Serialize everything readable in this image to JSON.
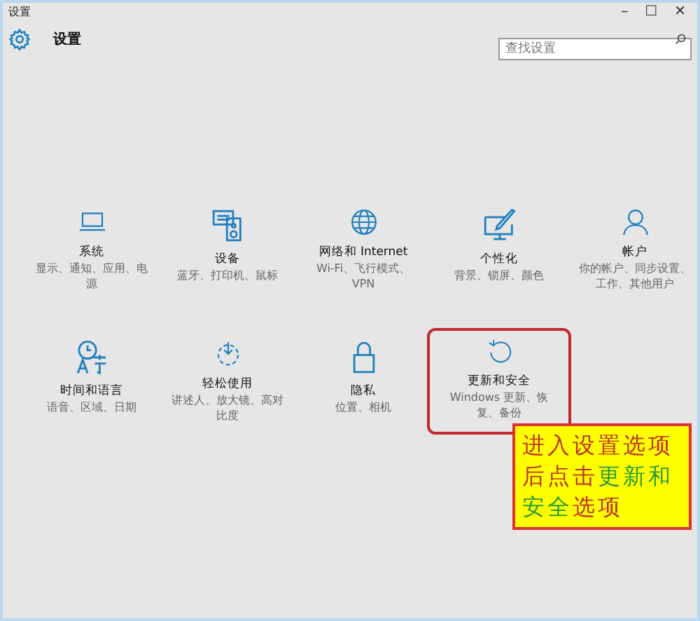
{
  "window": {
    "title": "设置",
    "controls": [
      "–",
      "☐",
      "✕"
    ]
  },
  "header": {
    "title": "设置"
  },
  "search": {
    "placeholder": "查找设置"
  },
  "tiles": [
    {
      "kind": "laptop",
      "label": "系统",
      "description": "显示、通知、应用、电源",
      "highlighted": false
    },
    {
      "kind": "devices",
      "label": "设备",
      "description": "蓝牙、打印机、鼠标",
      "highlighted": false
    },
    {
      "kind": "globe",
      "label": "网络和 Internet",
      "description": "Wi-Fi、飞行模式、VPN",
      "highlighted": false
    },
    {
      "kind": "paint",
      "label": "个性化",
      "description": "背景、锁屏、颜色",
      "highlighted": false
    },
    {
      "kind": "person",
      "label": "帐户",
      "description": "你的帐户、同步设置、工作、其他用户",
      "highlighted": false
    },
    {
      "kind": "time",
      "label": "时间和语言",
      "description": "语音、区域、日期",
      "highlighted": false
    },
    {
      "kind": "ease",
      "label": "轻松使用",
      "description": "讲述人、放大镜、高对比度",
      "highlighted": false
    },
    {
      "kind": "lock",
      "label": "隐私",
      "description": "位置、相机",
      "highlighted": false
    },
    {
      "kind": "update",
      "label": "更新和安全",
      "description": "Windows 更新、恢复、备份",
      "highlighted": true
    }
  ],
  "callout": {
    "parts": [
      {
        "text": "进入设置选项后点击",
        "highlight": false
      },
      {
        "text": "更新和安全",
        "highlight": true
      },
      {
        "text": "选项",
        "highlight": false
      }
    ]
  }
}
